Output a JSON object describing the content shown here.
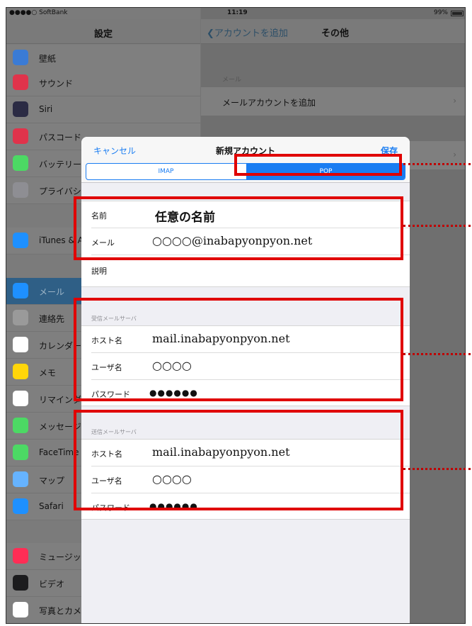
{
  "status_bar": {
    "carrier": "●●●●○ SoftBank",
    "time": "11:19",
    "battery": "99%"
  },
  "left_panel": {
    "title": "設定",
    "items": [
      {
        "label": "壁紙",
        "icon": "wallpaper-icon",
        "color": "#3a7bd5",
        "selected": false
      },
      {
        "label": "サウンド",
        "icon": "sound-icon",
        "color": "#e0334b",
        "selected": false
      },
      {
        "label": "Siri",
        "icon": "siri-icon",
        "color": "#2b2b44",
        "selected": false
      },
      {
        "label": "パスコード",
        "icon": "passcode-icon",
        "color": "#e0334b",
        "selected": false
      },
      {
        "label": "バッテリー",
        "icon": "battery-icon",
        "color": "#4cd964",
        "selected": false
      },
      {
        "label": "プライバシー",
        "icon": "privacy-icon",
        "color": "#8e8e93",
        "selected": false
      },
      {
        "label": "iTunes & App Store",
        "icon": "app-store-icon",
        "color": "#1e90ff",
        "selected": false
      },
      {
        "label": "メール",
        "icon": "mail-icon",
        "color": "#1e90ff",
        "selected": true
      },
      {
        "label": "連絡先",
        "icon": "contacts-icon",
        "color": "#9a9a9a",
        "selected": false
      },
      {
        "label": "カレンダー",
        "icon": "calendar-icon",
        "color": "#ffffff",
        "selected": false
      },
      {
        "label": "メモ",
        "icon": "notes-icon",
        "color": "#ffd60a",
        "selected": false
      },
      {
        "label": "リマインダー",
        "icon": "reminders-icon",
        "color": "#ffffff",
        "selected": false
      },
      {
        "label": "メッセージ",
        "icon": "messages-icon",
        "color": "#4cd964",
        "selected": false
      },
      {
        "label": "FaceTime",
        "icon": "facetime-icon",
        "color": "#4cd964",
        "selected": false
      },
      {
        "label": "マップ",
        "icon": "maps-icon",
        "color": "#66b3ff",
        "selected": false
      },
      {
        "label": "Safari",
        "icon": "safari-icon",
        "color": "#1e90ff",
        "selected": false
      },
      {
        "label": "ミュージック",
        "icon": "music-icon",
        "color": "#ff2d55",
        "selected": false
      },
      {
        "label": "ビデオ",
        "icon": "video-icon",
        "color": "#1c1c1e",
        "selected": false
      },
      {
        "label": "写真とカメラ",
        "icon": "photos-icon",
        "color": "#ffffff",
        "selected": false
      }
    ]
  },
  "right_panel": {
    "back_label": "アカウントを追加",
    "title": "その他",
    "mail_section": "メール",
    "add_mail_account": "メールアカウントを追加"
  },
  "modal": {
    "cancel": "キャンセル",
    "title": "新規アカウント",
    "save": "保存",
    "segments": [
      "IMAP",
      "POP"
    ],
    "selected_segment": "POP",
    "account": {
      "name_label": "名前",
      "name_value": "任意の名前",
      "email_label": "メール",
      "email_value": "○○○○@inabapyonpyon.net",
      "description_label": "説明"
    },
    "incoming": {
      "header": "受信メールサーバ",
      "host_label": "ホスト名",
      "host_value": "mail.inabapyonpyon.net",
      "user_label": "ユーザ名",
      "user_value": "○○○○",
      "password_label": "パスワード",
      "password_value": "●●●●●●"
    },
    "outgoing": {
      "header": "送信メールサーバ",
      "host_label": "ホスト名",
      "host_value": "mail.inabapyonpyon.net",
      "user_label": "ユーザ名",
      "user_value": "○○○○",
      "password_label": "パスワード",
      "password_value": "●●●●●●"
    }
  },
  "colors": {
    "accent": "#1a7df2",
    "annotation_red": "#e00000"
  }
}
